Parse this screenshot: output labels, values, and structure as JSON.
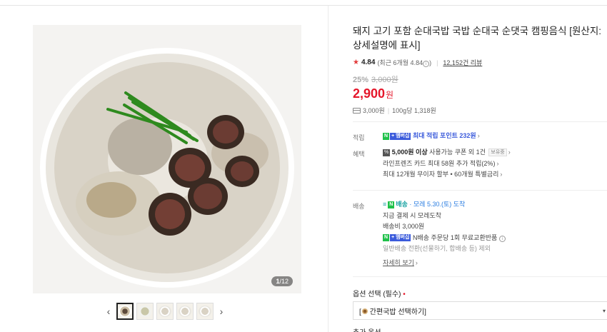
{
  "gallery": {
    "counter_current": "1",
    "counter_total": "/12",
    "prev": "‹",
    "next": "›"
  },
  "product": {
    "title_line1": "돼지 고기 포함 순대국밥 국밥 순대국 순댓국 캠핑음식 [원산지:",
    "title_line2": "상세설명에 표시]",
    "rating_score": "4.84",
    "rating_recent": "(최근 6개월 4.84",
    "rating_recent_close": ")",
    "review_count": "12,152건 리뷰",
    "discount_rate": "25%",
    "original_price": "3,000원",
    "price": "2,900",
    "currency": "원",
    "unit_price_1": "3,000원",
    "unit_price_2": "100g당 1,318원"
  },
  "benefits": {
    "points_label": "적립",
    "npay_badge": "N",
    "plus_badge": "+ 멤버십",
    "points_text": "최대 적립 포인트 232원",
    "discount_label": "혜택",
    "coupon_icon": "%",
    "coupon_text": "5,000원 이상",
    "coupon_text2": " 사용가능 쿠폰 외 1건",
    "coupon_badge": "보유중",
    "card_text": "라인프렌즈 카드 최대 58원 추가 적립(2%)",
    "installment_text": "최대 12개월 무이자 할부 • 60개월 특별금리"
  },
  "shipping": {
    "label": "배송",
    "delivery_type": "배송",
    "delivery_date": "· 모레 5.30.(토) 도착",
    "payment_note": "지금 결제 시 모레도착",
    "fee": "배송비 3,000원",
    "n_delivery": "N배송 주문당 1회 무료교환반품",
    "exclusion": "일반배송 전환(선물하기, 합배송 등) 제외",
    "detail_link": "자세히 보기"
  },
  "options": {
    "label": "옵션 선택 (필수)",
    "required_mark": "•",
    "select_value": "[ 간편국밥 선택하기]",
    "extra_label": "추가 옵션"
  },
  "colors": {
    "price_red": "#e5162a",
    "npay_green": "#1fc14a",
    "link_blue": "#3b5bdb"
  }
}
